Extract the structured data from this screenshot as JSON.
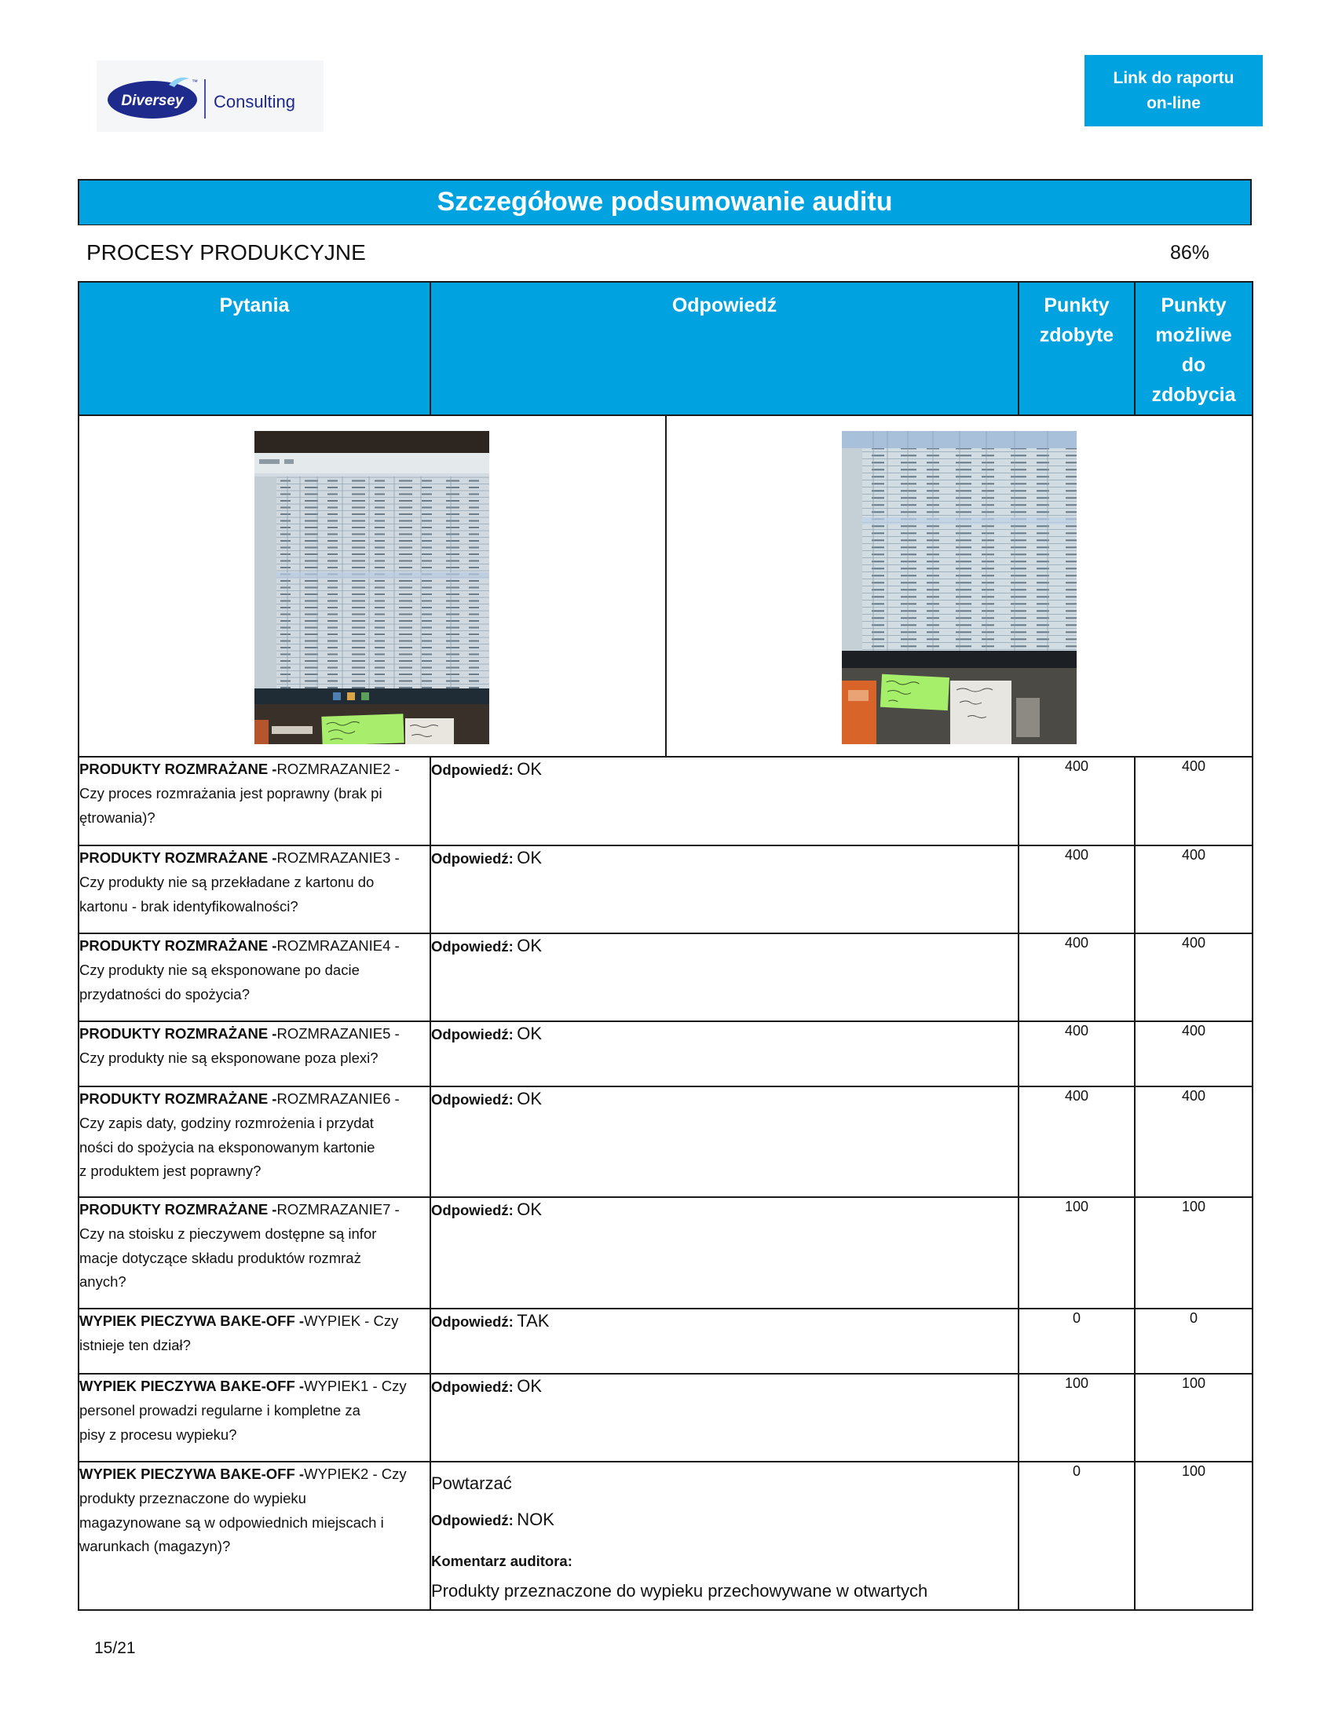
{
  "logo": {
    "brand": "Diversey",
    "tm": "™",
    "division": "Consulting"
  },
  "link_button": {
    "lines": [
      "Link do raportu",
      "on-line"
    ]
  },
  "title": "Szczegółowe podsumowanie auditu",
  "section": {
    "name": "PROCESY PRODUKCYJNE",
    "score": "86%"
  },
  "columns": {
    "question": "Pytania",
    "answer": "Odpowiedź",
    "earned": "Punkty zdobyte",
    "possible": "Punkty możliwe do zdobycia"
  },
  "answer_label": "Odpowiedź:",
  "comment_label": "Komentarz auditora:",
  "rows": [
    {
      "category": "PRODUKTY ROZMRAŻANE -",
      "question": "ROZMRAZANIE2 -\nCzy proces rozmrażania jest poprawny (brak pi\nętrowania)?",
      "answer": "OK",
      "earned": "400",
      "possible": "400"
    },
    {
      "category": "PRODUKTY ROZMRAŻANE -",
      "question": "ROZMRAZANIE3 -\nCzy produkty nie są przekładane z kartonu do\nkartonu - brak identyfikowalności?",
      "answer": "OK",
      "earned": "400",
      "possible": "400"
    },
    {
      "category": "PRODUKTY ROZMRAŻANE -",
      "question": "ROZMRAZANIE4 -\nCzy produkty nie są eksponowane po dacie\nprzydatności do spożycia?",
      "answer": "OK",
      "earned": "400",
      "possible": "400"
    },
    {
      "category": "PRODUKTY ROZMRAŻANE -",
      "question": "ROZMRAZANIE5 -\nCzy produkty nie są eksponowane poza plexi?",
      "answer": "OK",
      "earned": "400",
      "possible": "400"
    },
    {
      "category": "PRODUKTY ROZMRAŻANE -",
      "question": "ROZMRAZANIE6 -\nCzy zapis daty, godziny rozmrożenia i przydat\nności do spożycia na eksponowanym kartonie\nz produktem jest poprawny?",
      "answer": "OK",
      "earned": "400",
      "possible": "400"
    },
    {
      "category": "PRODUKTY ROZMRAŻANE -",
      "question": "ROZMRAZANIE7 -\nCzy na stoisku z pieczywem dostępne są infor\nmacje dotyczące składu produktów rozmraż\nanych?",
      "answer": "OK",
      "earned": "100",
      "possible": "100"
    },
    {
      "category": "WYPIEK PIECZYWA BAKE-OFF -",
      "question": "WYPIEK - Czy\nistnieje ten dział?",
      "answer": "TAK",
      "earned": "0",
      "possible": "0"
    },
    {
      "category": "WYPIEK PIECZYWA BAKE-OFF -",
      "question": "WYPIEK1 - Czy\npersonel prowadzi regularne i kompletne za\npisy z procesu wypieku?",
      "answer": "OK",
      "earned": "100",
      "possible": "100"
    },
    {
      "category": "WYPIEK PIECZYWA BAKE-OFF -",
      "question": "WYPIEK2 - Czy\nprodukty przeznaczone do wypieku\nmagazynowane są w odpowiednich miejscach i\nwarunkach (magazyn)?",
      "note": "Powtarzać",
      "answer": "NOK",
      "comment": "Produkty przeznaczone do wypieku przechowywane w otwartych",
      "earned": "0",
      "possible": "100"
    }
  ],
  "page": "15/21",
  "colors": {
    "accent": "#00a3e0",
    "logo_blue": "#1e2a8c",
    "sticky_note": "#a8ee6c"
  }
}
